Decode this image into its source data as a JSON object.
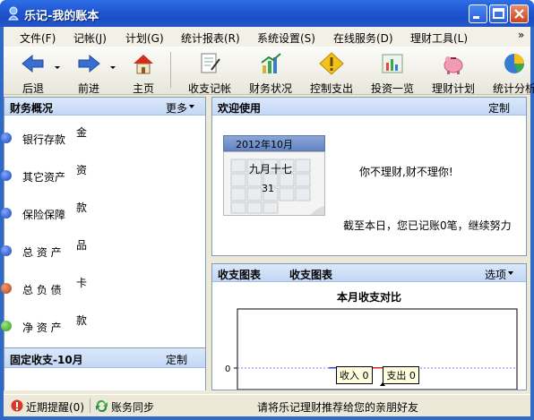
{
  "window": {
    "title": "乐记-我的账本"
  },
  "menu": [
    "文件(F)",
    "记帐(J)",
    "计划(G)",
    "统计报表(R)",
    "系统设置(S)",
    "在线服务(D)",
    "理财工具(L)"
  ],
  "menu_overflow": "»",
  "toolbar": {
    "back": "后退",
    "forward": "前进",
    "home": "主页",
    "items": [
      "收支记帐",
      "财务状况",
      "控制支出",
      "投资一览",
      "理财计划",
      "统计分析"
    ]
  },
  "finance": {
    "title": "财务概况",
    "more": "更多",
    "rows": [
      {
        "label": "银行存款",
        "clip": "金"
      },
      {
        "label": "其它资产",
        "clip": "资"
      },
      {
        "label": "保险保障",
        "clip": "款"
      },
      {
        "label": "总 资 产",
        "clip": "品"
      },
      {
        "label": "总 负 债",
        "clip": "卡"
      },
      {
        "label": "净 资 产",
        "clip": "款"
      }
    ]
  },
  "fixed": {
    "title": "固定收支-10月",
    "action": "定制"
  },
  "welcome": {
    "title": "欢迎使用",
    "action": "定制",
    "calendar_month": "2012年10月",
    "lunar": "九月十七",
    "day": "31",
    "slogan": "你不理财,财不理你!",
    "summary": "截至本日，您已记账0笔，继续努力"
  },
  "chart": {
    "tab1": "收支图表",
    "tab2": "收支图表",
    "options": "选项",
    "chart_data": {
      "type": "bar",
      "title": "本月收支对比",
      "categories": [
        "收入",
        "支出"
      ],
      "values": [
        0,
        0
      ],
      "legend": [
        "收入 0",
        "支出 0"
      ],
      "y_tick": "0"
    }
  },
  "status": {
    "reminder": "近期提醒(0)",
    "sync": "账务同步",
    "message": "请将乐记理财推荐给您的亲朋好友"
  },
  "colors": {
    "titlebar": "#1f55d0",
    "income": "#2e4bd6",
    "expense": "#d22b2b"
  }
}
